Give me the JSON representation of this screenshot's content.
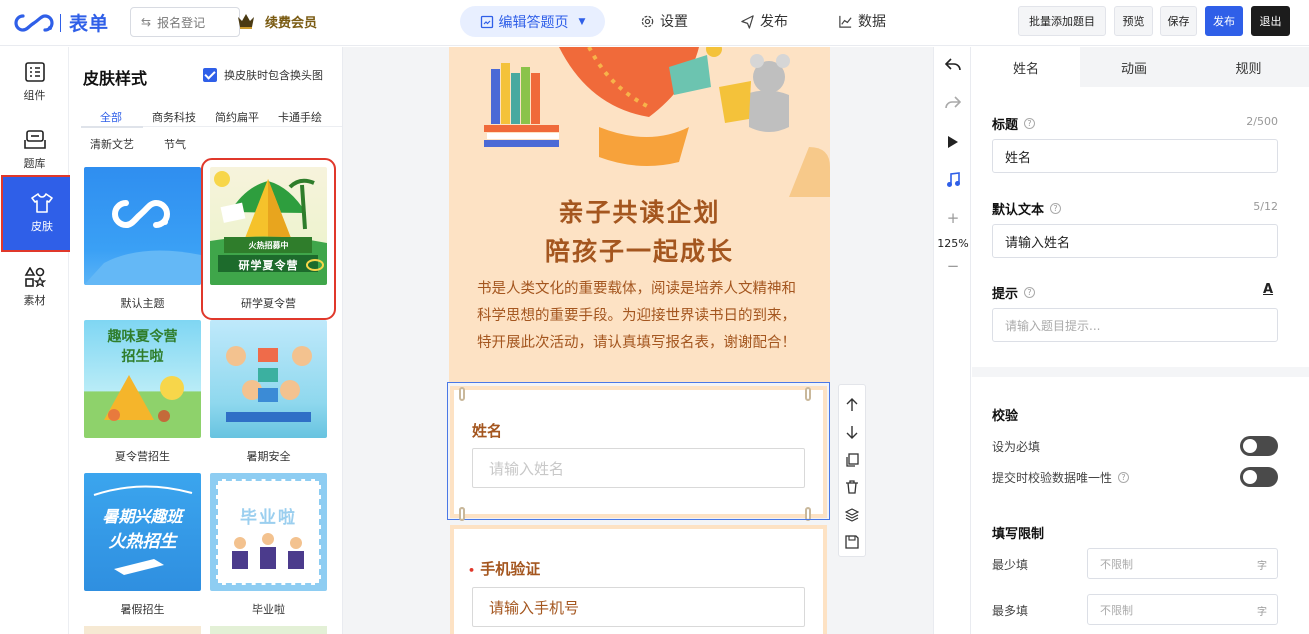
{
  "topbar": {
    "logo_text": "表单",
    "back_label": "报名登记",
    "vip_label": "续费会员",
    "mode_label": "编辑答题页",
    "nav": [
      {
        "label": "设置",
        "icon": "gear-icon"
      },
      {
        "label": "发布",
        "icon": "send-icon"
      },
      {
        "label": "数据",
        "icon": "chart-icon"
      }
    ],
    "buttons": {
      "batch_add": "批量添加题目",
      "preview": "预览",
      "save": "保存",
      "publish": "发布",
      "exit": "退出"
    }
  },
  "leftnav": {
    "items": [
      {
        "label": "组件",
        "icon": "components-icon"
      },
      {
        "label": "题库",
        "icon": "question-bank-icon"
      },
      {
        "label": "皮肤",
        "icon": "shirt-icon"
      },
      {
        "label": "素材",
        "icon": "material-icon"
      }
    ],
    "active_index": 2
  },
  "skins": {
    "title": "皮肤样式",
    "checkbox_label": "换皮肤时包含换头图",
    "checkbox_checked": true,
    "categories": [
      "全部",
      "商务科技",
      "简约扁平",
      "卡通手绘",
      "清新文艺",
      "节气"
    ],
    "active_category": 0,
    "themes": [
      {
        "label": "默认主题",
        "art": "default"
      },
      {
        "label": "研学夏令营",
        "art": "camp",
        "banner": "火热招募中",
        "subtitle": "研学夏令营",
        "selected": true
      },
      {
        "label": "夏令营招生",
        "art": "summer",
        "headline": "趣味夏令营",
        "headline2": "招生啦"
      },
      {
        "label": "暑期安全",
        "art": "safety"
      },
      {
        "label": "暑假招生",
        "art": "interest",
        "headline": "暑期兴趣班",
        "headline2": "火热招生"
      },
      {
        "label": "毕业啦",
        "art": "graduate",
        "headline": "毕业啦"
      }
    ]
  },
  "form": {
    "poster_title_1": "亲子共读企划",
    "poster_title_2": "陪孩子一起成长",
    "poster_desc": "书是人类文化的重要载体，阅读是培养人文精神和科学思想的重要手段。为迎接世界读书日的到来，特开展此次活动，请认真填写报名表，谢谢配合！",
    "questions": [
      {
        "label": "姓名",
        "placeholder": "请输入姓名",
        "required": false
      },
      {
        "label": "手机验证",
        "placeholder": "请输入手机号",
        "required": true,
        "required_mark": "•"
      }
    ]
  },
  "vtools": {
    "zoom": "125%"
  },
  "props": {
    "tabs": [
      "姓名",
      "动画",
      "规则"
    ],
    "active_tab": 0,
    "title_label": "标题",
    "title_count": "2/500",
    "title_value": "姓名",
    "default_label": "默认文本",
    "default_count": "5/12",
    "default_value": "请输入姓名",
    "hint_label": "提示",
    "hint_style": "A",
    "hint_placeholder": "请输入题目提示...",
    "validate_label": "校验",
    "required_label": "设为必填",
    "unique_label": "提交时校验数据唯一性",
    "limit_label": "填写限制",
    "min_label": "最少填",
    "max_label": "最多填",
    "unlimited": "不限制",
    "unit": "字"
  },
  "colors": {
    "accent": "#2f5fe8",
    "poster_bg": "#fde2c4",
    "poster_text": "#a4561f",
    "highlight": "#e0382b"
  }
}
